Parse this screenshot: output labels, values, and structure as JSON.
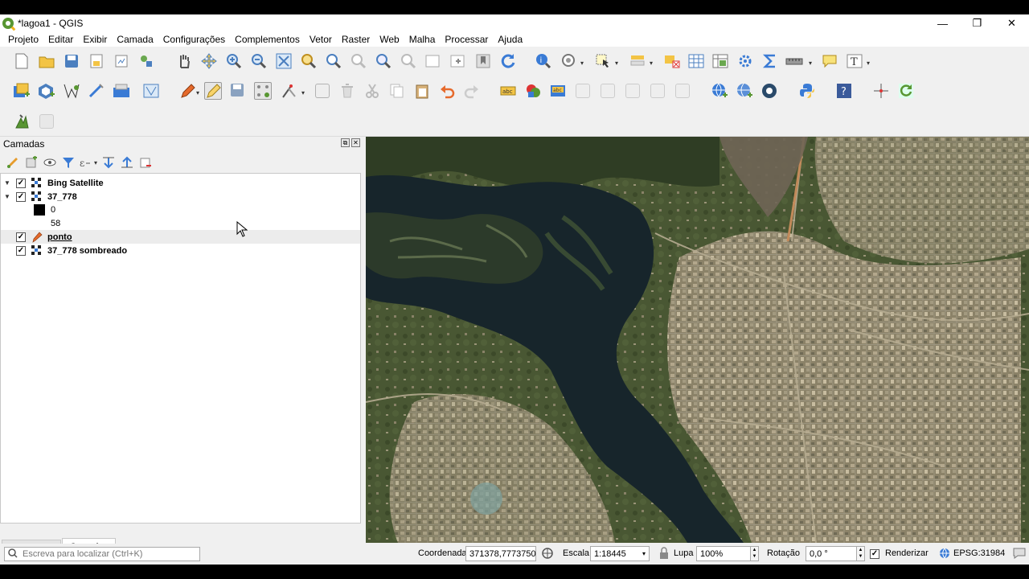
{
  "window": {
    "title": "*lagoa1 - QGIS",
    "min": "—",
    "restore": "❐",
    "close": "✕"
  },
  "menu": [
    "Projeto",
    "Editar",
    "Exibir",
    "Camada",
    "Configurações",
    "Complementos",
    "Vetor",
    "Raster",
    "Web",
    "Malha",
    "Processar",
    "Ajuda"
  ],
  "layers_panel": {
    "title": "Camadas",
    "layers": [
      {
        "name": "Bing Satellite",
        "checked": true,
        "expanded": true
      },
      {
        "name": "37_778",
        "checked": true,
        "expanded": true,
        "legend": [
          "0",
          "58"
        ]
      },
      {
        "name": "ponto",
        "checked": true,
        "selected": true
      },
      {
        "name": "37_778 sombreado",
        "checked": true
      }
    ]
  },
  "tabs": {
    "navigator": "Navegador",
    "layers": "Camadas"
  },
  "status": {
    "locator_placeholder": "Escreva para localizar (Ctrl+K)",
    "coord_label": "Coordenada",
    "coord_value": "371378,7773750",
    "scale_label": "Escala",
    "scale_value": "1:18445",
    "magnifier_label": "Lupa",
    "magnifier_value": "100%",
    "rotation_label": "Rotação",
    "rotation_value": "0,0 °",
    "render_label": "Renderizar",
    "crs": "EPSG:31984"
  },
  "colors": {
    "accent": "#589632",
    "map_water": "#16232a",
    "map_veg": "#3d4a2c",
    "urban": "#8a8066"
  }
}
